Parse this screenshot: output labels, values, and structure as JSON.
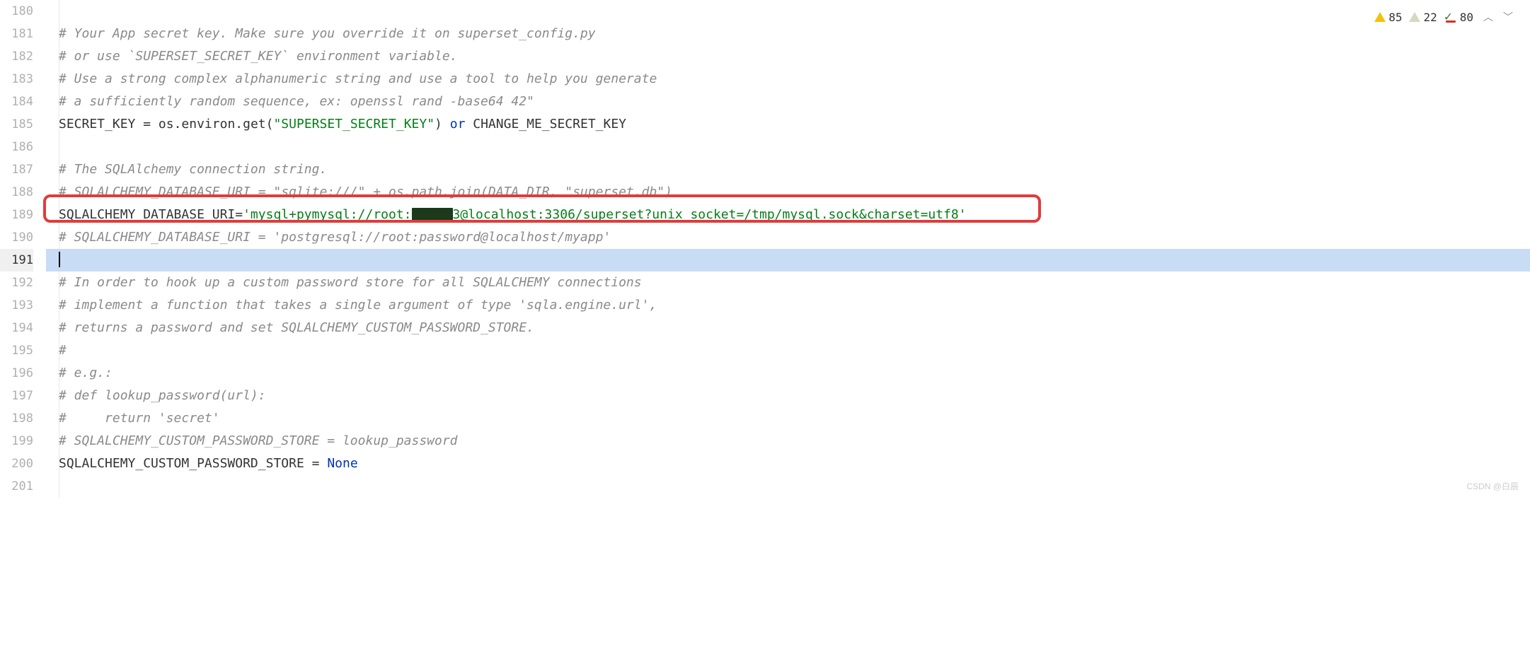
{
  "inspections": {
    "warning_strong": "85",
    "warning_weak": "22",
    "typo": "80"
  },
  "line_numbers": [
    "180",
    "181",
    "182",
    "183",
    "184",
    "185",
    "186",
    "187",
    "188",
    "189",
    "190",
    "191",
    "192",
    "193",
    "194",
    "195",
    "196",
    "197",
    "198",
    "199",
    "200",
    "201"
  ],
  "active_line": "191",
  "highlight_line": "189",
  "code": {
    "l181": "# Your App secret key. Make sure you override it on superset_config.py",
    "l182": "# or use `SUPERSET_SECRET_KEY` environment variable.",
    "l183": "# Use a strong complex alphanumeric string and use a tool to help you generate",
    "l184": "# a sufficiently random sequence, ex: openssl rand -base64 42\"",
    "l185_var": "SECRET_KEY ",
    "l185_eq": "= ",
    "l185_os": "os.environ.get(",
    "l185_str": "\"SUPERSET_SECRET_KEY\"",
    "l185_close": ") ",
    "l185_or": "or",
    "l185_rest": " CHANGE_ME_SECRET_KEY",
    "l187": "# The SQLAlchemy connection string.",
    "l188": "# SQLALCHEMY_DATABASE_URI = \"sqlite:///\" + os.path.join(DATA_DIR, \"superset.db\")",
    "l189_var": "SQLALCHEMY_DATABASE_URI",
    "l189_eq": "=",
    "l189_str1": "'mysql+pymysql://root:",
    "l189_str2": "3@localhost:3306/superset?unix_socket=/tmp/mysql.sock&charset=utf8'",
    "l190": "# SQLALCHEMY_DATABASE_URI = 'postgresql://root:password@localhost/myapp'",
    "l192": "# In order to hook up a custom password store for all SQLALCHEMY connections",
    "l193": "# implement a function that takes a single argument of type 'sqla.engine.url',",
    "l194": "# returns a password and set SQLALCHEMY_CUSTOM_PASSWORD_STORE.",
    "l195": "#",
    "l196": "# e.g.:",
    "l197": "# def lookup_password(url):",
    "l198": "#     return 'secret'",
    "l199": "# SQLALCHEMY_CUSTOM_PASSWORD_STORE = lookup_password",
    "l200_var": "SQLALCHEMY_CUSTOM_PASSWORD_STORE ",
    "l200_eq": "= ",
    "l200_none": "None"
  },
  "watermark": "CSDN @白辰"
}
